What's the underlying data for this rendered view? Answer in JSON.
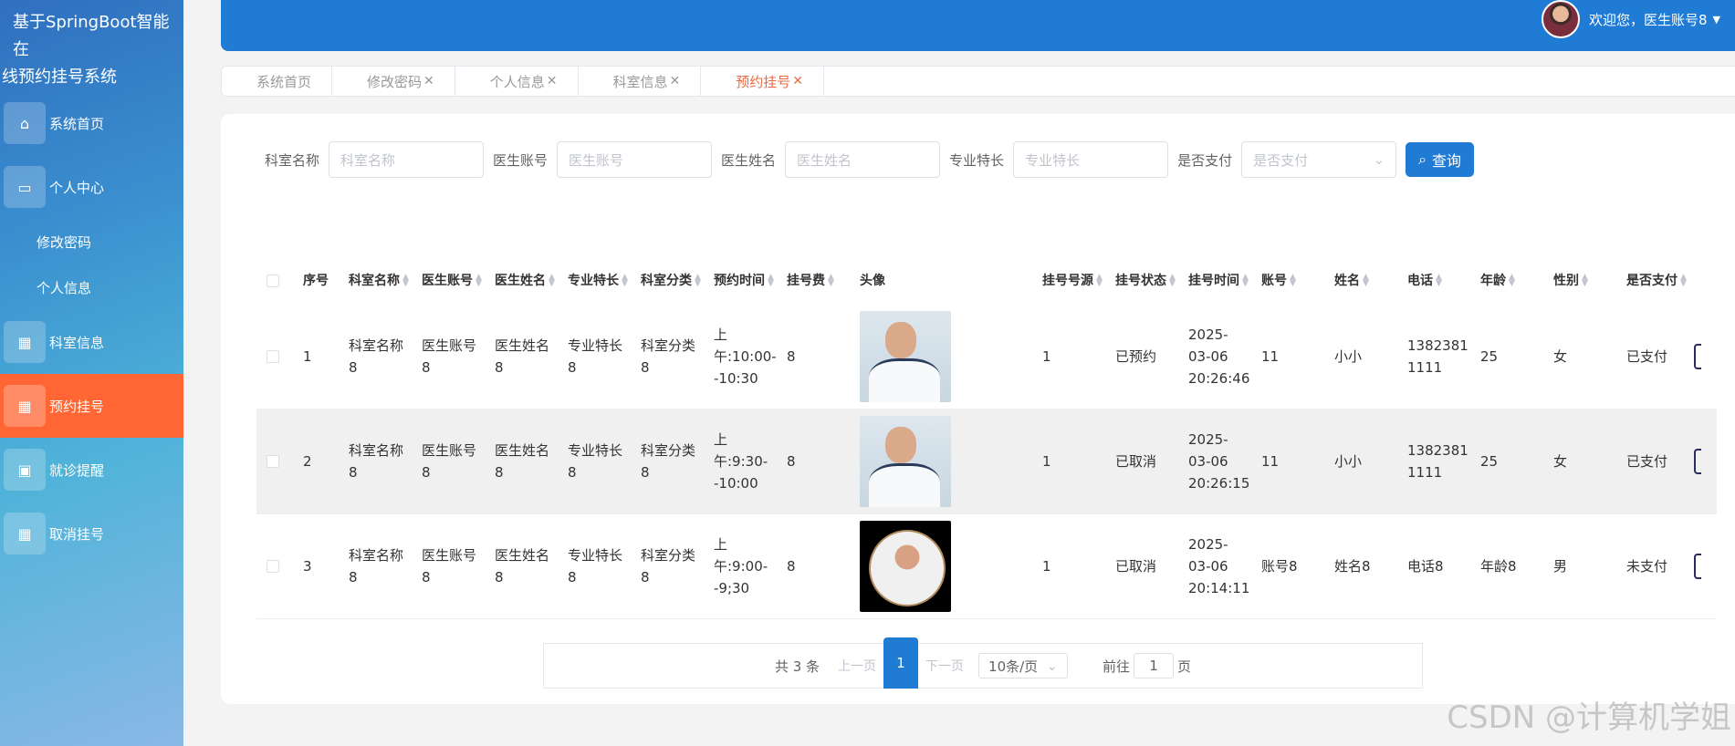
{
  "brand": {
    "line1": "基于SpringBoot智能在",
    "line2": "线预约挂号系统"
  },
  "sidebar": {
    "items": [
      {
        "label": "系统首页",
        "icon": "home-icon"
      },
      {
        "label": "个人中心",
        "icon": "card-icon"
      },
      {
        "label": "修改密码",
        "sub": true
      },
      {
        "label": "个人信息",
        "sub": true
      },
      {
        "label": "科室信息",
        "icon": "grid-icon"
      },
      {
        "label": "预约挂号",
        "icon": "grid-icon",
        "active": true
      },
      {
        "label": "就诊提醒",
        "icon": "briefcase-icon"
      },
      {
        "label": "取消挂号",
        "icon": "grid-icon"
      }
    ]
  },
  "header": {
    "welcome": "欢迎您，医生账号8",
    "caret": "▼"
  },
  "tabs": [
    {
      "label": "系统首页",
      "close": ""
    },
    {
      "label": "修改密码",
      "close": "✕"
    },
    {
      "label": "个人信息",
      "close": "✕"
    },
    {
      "label": "科室信息",
      "close": "✕"
    },
    {
      "label": "预约挂号",
      "close": "✕",
      "active": true
    }
  ],
  "search": {
    "fields": [
      {
        "label": "科室名称",
        "placeholder": "科室名称"
      },
      {
        "label": "医生账号",
        "placeholder": "医生账号"
      },
      {
        "label": "医生姓名",
        "placeholder": "医生姓名"
      },
      {
        "label": "专业特长",
        "placeholder": "专业特长"
      }
    ],
    "select": {
      "label": "是否支付",
      "placeholder": "是否支付"
    },
    "button": "查询"
  },
  "table": {
    "columns": [
      "序号",
      "科室名称",
      "医生账号",
      "医生姓名",
      "专业特长",
      "科室分类",
      "预约时间",
      "挂号费",
      "头像",
      "挂号号源",
      "挂号状态",
      "挂号时间",
      "账号",
      "姓名",
      "电话",
      "年龄",
      "性别",
      "是否支付"
    ],
    "rows": [
      [
        "1",
        "科室名称8",
        "医生账号8",
        "医生姓名8",
        "专业特长8",
        "科室分类8",
        "上午:10:00--10:30",
        "8",
        "",
        "1",
        "已预约",
        "2025-03-06 20:26:46",
        "11",
        "小小",
        "13823811111",
        "25",
        "女",
        "已支付"
      ],
      [
        "2",
        "科室名称8",
        "医生账号8",
        "医生姓名8",
        "专业特长8",
        "科室分类8",
        "上午:9:30--10:00",
        "8",
        "",
        "1",
        "已取消",
        "2025-03-06 20:26:15",
        "11",
        "小小",
        "13823811111",
        "25",
        "女",
        "已支付"
      ],
      [
        "3",
        "科室名称8",
        "医生账号8",
        "医生姓名8",
        "专业特长8",
        "科室分类8",
        "上午:9:00--9;30",
        "8",
        "",
        "1",
        "已取消",
        "2025-03-06 20:14:11",
        "账号8",
        "姓名8",
        "电话8",
        "年龄8",
        "男",
        "未支付"
      ]
    ]
  },
  "pager": {
    "total": "共 3 条",
    "prev": "上一页",
    "current": "1",
    "next": "下一页",
    "size": "10条/页",
    "goto_prefix": "前往",
    "goto_value": "1",
    "goto_suffix": "页"
  },
  "watermark": "CSDN @计算机学姐",
  "colors": {
    "primary": "#1f7bd4",
    "active": "#ff6633",
    "tab_active": "#e86a45"
  }
}
